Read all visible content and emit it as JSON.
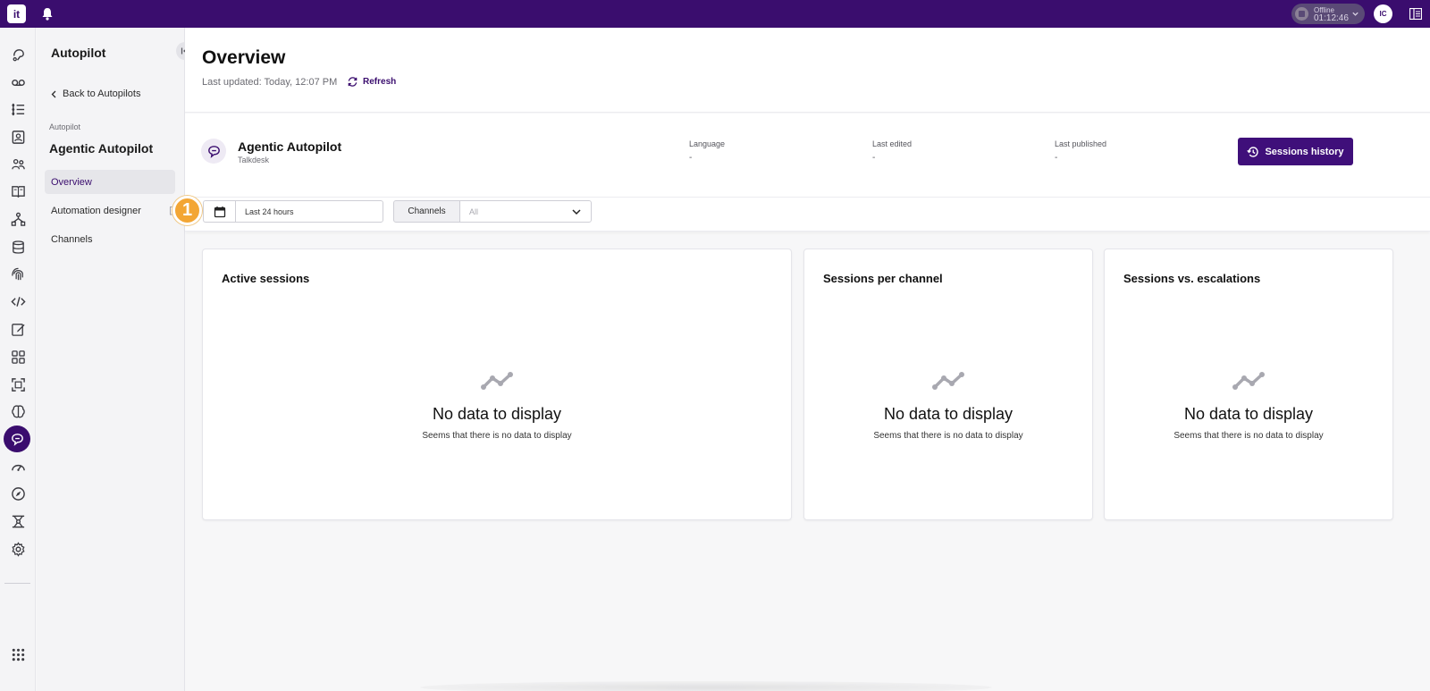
{
  "topbar": {
    "logo_text": "it",
    "status": {
      "label": "Offline",
      "timer": "01:12:46"
    },
    "user_initials": "IC"
  },
  "rail_icons": [
    "live-icon",
    "voicemail-icon",
    "queue-list-icon",
    "contacts-icon",
    "agents-icon",
    "knowledge-book-icon",
    "workflow-icon",
    "database-icon",
    "fingerprint-icon",
    "code-icon",
    "edit-icon",
    "apps-grid-icon",
    "capture-icon",
    "brain-icon",
    "autopilot-chat-icon",
    "speedometer-icon",
    "compass-icon",
    "hierarchy-icon",
    "settings-icon",
    "app-launcher-icon"
  ],
  "sidebar": {
    "title": "Autopilot",
    "back_label": "Back to Autopilots",
    "section_small": "Autopilot",
    "section_heading": "Agentic Autopilot",
    "items": [
      {
        "label": "Overview",
        "active": true
      },
      {
        "label": "Automation designer",
        "external": true
      },
      {
        "label": "Channels"
      }
    ]
  },
  "header": {
    "title": "Overview",
    "last_updated": "Last updated: Today, 12:07 PM",
    "refresh_label": "Refresh"
  },
  "info": {
    "name": "Agentic Autopilot",
    "org": "Talkdesk",
    "language_label": "Language",
    "language_value": "-",
    "last_edited_label": "Last edited",
    "last_edited_value": "-",
    "last_published_label": "Last published",
    "last_published_value": "-",
    "sessions_button": "Sessions history"
  },
  "filters": {
    "date_value": "Last 24 hours",
    "badge": "1",
    "channels_label": "Channels",
    "channels_placeholder": "All"
  },
  "cards": [
    {
      "title": "Active sessions",
      "empty_title": "No data to display",
      "empty_sub": "Seems that there is no data to display"
    },
    {
      "title": "Sessions per channel",
      "empty_title": "No data to display",
      "empty_sub": "Seems that there is no data to display"
    },
    {
      "title": "Sessions vs. escalations",
      "empty_title": "No data to display",
      "empty_sub": "Seems that there is no data to display"
    }
  ],
  "colors": {
    "brand": "#3a0d6e",
    "button": "#3f0f7a",
    "badge": "#f3a634"
  }
}
